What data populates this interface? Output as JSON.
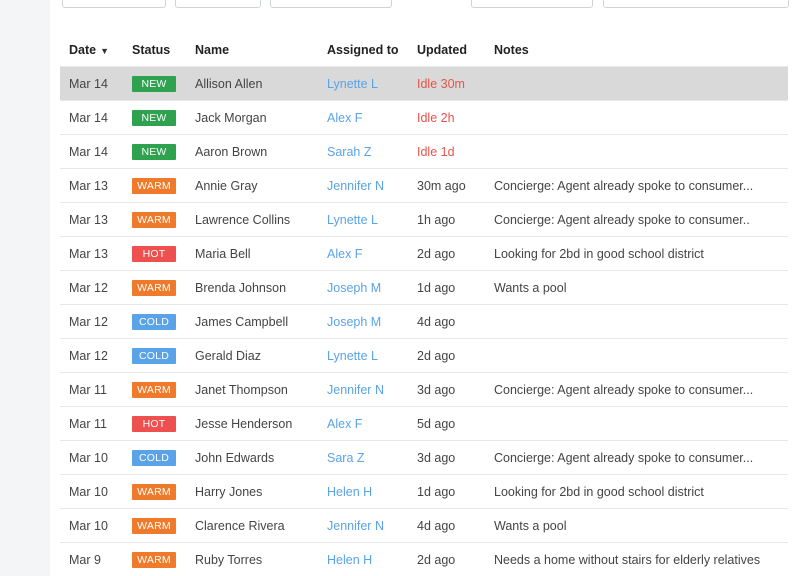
{
  "toolbar": {
    "filters": [
      {
        "label": "",
        "name": "filter-dropdown-1"
      },
      {
        "label": "",
        "name": "filter-dropdown-2"
      },
      {
        "label": "",
        "name": "filter-dropdown-3"
      }
    ],
    "actions": [
      {
        "label": "",
        "name": "action-button-1"
      },
      {
        "label": "",
        "name": "action-button-2"
      }
    ]
  },
  "table": {
    "headers": {
      "date": "Date",
      "status": "Status",
      "name": "Name",
      "assigned": "Assigned to",
      "updated": "Updated",
      "notes": "Notes"
    },
    "rows": [
      {
        "date": "Mar 14",
        "status": "NEW",
        "name": "Allison Allen",
        "assigned": "Lynette L",
        "updated": "Idle 30m",
        "idle": true,
        "notes": "",
        "selected": true
      },
      {
        "date": "Mar 14",
        "status": "NEW",
        "name": "Jack Morgan",
        "assigned": "Alex F",
        "updated": "Idle 2h",
        "idle": true,
        "notes": ""
      },
      {
        "date": "Mar 14",
        "status": "NEW",
        "name": "Aaron Brown",
        "assigned": "Sarah Z",
        "updated": "Idle 1d",
        "idle": true,
        "notes": ""
      },
      {
        "date": "Mar 13",
        "status": "WARM",
        "name": "Annie Gray",
        "assigned": "Jennifer N",
        "updated": "30m ago",
        "notes": "Concierge: Agent already spoke to consumer..."
      },
      {
        "date": "Mar 13",
        "status": "WARM",
        "name": "Lawrence Collins",
        "assigned": "Lynette L",
        "updated": "1h ago",
        "notes": "Concierge: Agent already spoke to consumer.."
      },
      {
        "date": "Mar 13",
        "status": "HOT",
        "name": "Maria Bell",
        "assigned": "Alex F",
        "updated": "2d ago",
        "notes": "Looking for 2bd in good school district"
      },
      {
        "date": "Mar 12",
        "status": "WARM",
        "name": "Brenda Johnson",
        "assigned": "Joseph M",
        "updated": "1d ago",
        "notes": "Wants a pool"
      },
      {
        "date": "Mar 12",
        "status": "COLD",
        "name": "James Campbell",
        "assigned": "Joseph M",
        "updated": "4d ago",
        "notes": ""
      },
      {
        "date": "Mar 12",
        "status": "COLD",
        "name": "Gerald Diaz",
        "assigned": "Lynette L",
        "updated": "2d ago",
        "notes": ""
      },
      {
        "date": "Mar 11",
        "status": "WARM",
        "name": "Janet Thompson",
        "assigned": "Jennifer N",
        "updated": "3d ago",
        "notes": "Concierge: Agent already spoke to consumer..."
      },
      {
        "date": "Mar 11",
        "status": "HOT",
        "name": "Jesse Henderson",
        "assigned": "Alex F",
        "updated": "5d ago",
        "notes": ""
      },
      {
        "date": "Mar 10",
        "status": "COLD",
        "name": "John Edwards",
        "assigned": "Sara Z",
        "updated": "3d ago",
        "notes": "Concierge: Agent already spoke to consumer..."
      },
      {
        "date": "Mar 10",
        "status": "WARM",
        "name": "Harry Jones",
        "assigned": "Helen H",
        "updated": "1d ago",
        "notes": "Looking for 2bd in good school district"
      },
      {
        "date": "Mar 10",
        "status": "WARM",
        "name": "Clarence Rivera",
        "assigned": "Jennifer N",
        "updated": "4d ago",
        "notes": "Wants a pool"
      },
      {
        "date": "Mar 9",
        "status": "WARM",
        "name": "Ruby Torres",
        "assigned": "Helen H",
        "updated": "2d ago",
        "notes": "Needs a home without stairs for elderly relatives"
      }
    ]
  },
  "status_colors": {
    "NEW": "#2fa24f",
    "WARM": "#f07a2b",
    "HOT": "#ee4f4f",
    "COLD": "#5aa3e8"
  },
  "icons": {
    "sort": "sort-down-icon"
  }
}
